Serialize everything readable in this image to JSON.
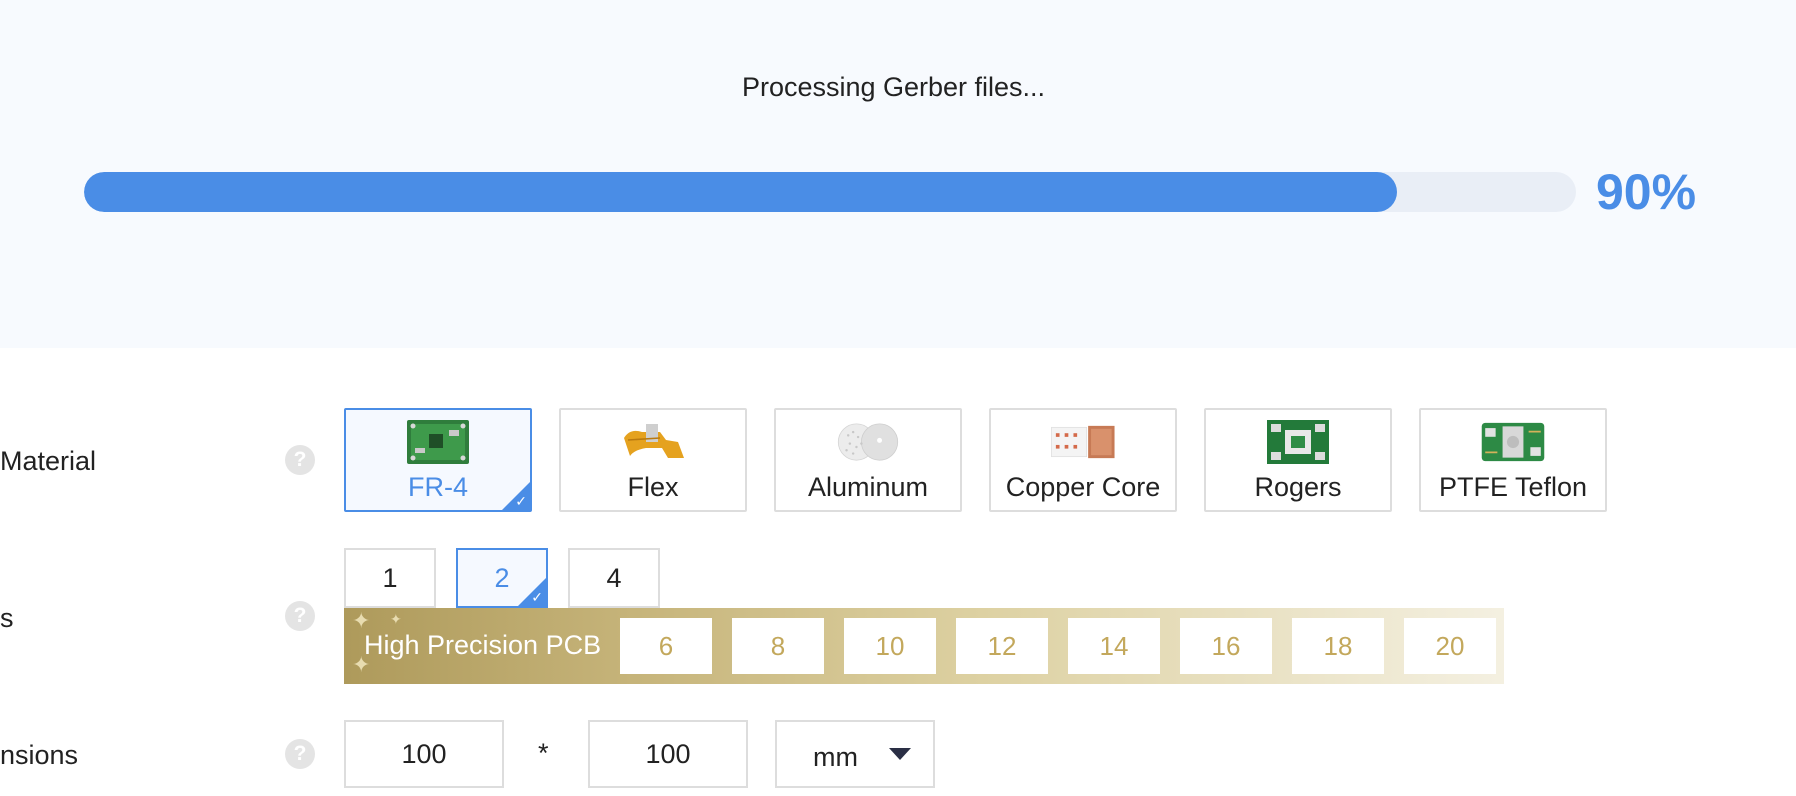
{
  "progress": {
    "message": "Processing Gerber files...",
    "percent_label": "90%",
    "value": 0.88,
    "fill_color": "#4a8de6",
    "track_color": "#e9eef6"
  },
  "material": {
    "label": "Material",
    "help_icon": "?",
    "options": [
      {
        "label": "FR-4",
        "icon": "fr4-board-icon",
        "selected": true
      },
      {
        "label": "Flex",
        "icon": "flex-pcb-icon",
        "selected": false
      },
      {
        "label": "Aluminum",
        "icon": "aluminum-pcb-icon",
        "selected": false
      },
      {
        "label": "Copper Core",
        "icon": "copper-core-pcb-icon",
        "selected": false
      },
      {
        "label": "Rogers",
        "icon": "rogers-pcb-icon",
        "selected": false
      },
      {
        "label": "PTFE Teflon",
        "icon": "ptfe-teflon-pcb-icon",
        "selected": false
      }
    ]
  },
  "layers": {
    "label": "s",
    "help_icon": "?",
    "options": [
      {
        "label": "1",
        "selected": false
      },
      {
        "label": "2",
        "selected": true
      },
      {
        "label": "4",
        "selected": false
      }
    ],
    "high_precision": {
      "title": "High Precision PCB",
      "options": [
        "6",
        "8",
        "10",
        "12",
        "14",
        "16",
        "18",
        "20"
      ]
    }
  },
  "dimensions": {
    "label": "nsions",
    "help_icon": "?",
    "width": "100",
    "separator": "*",
    "height": "100",
    "unit": "mm"
  },
  "check_mark": "✓",
  "accent_color": "#4a8de6",
  "gold_color": "#c3a85c"
}
